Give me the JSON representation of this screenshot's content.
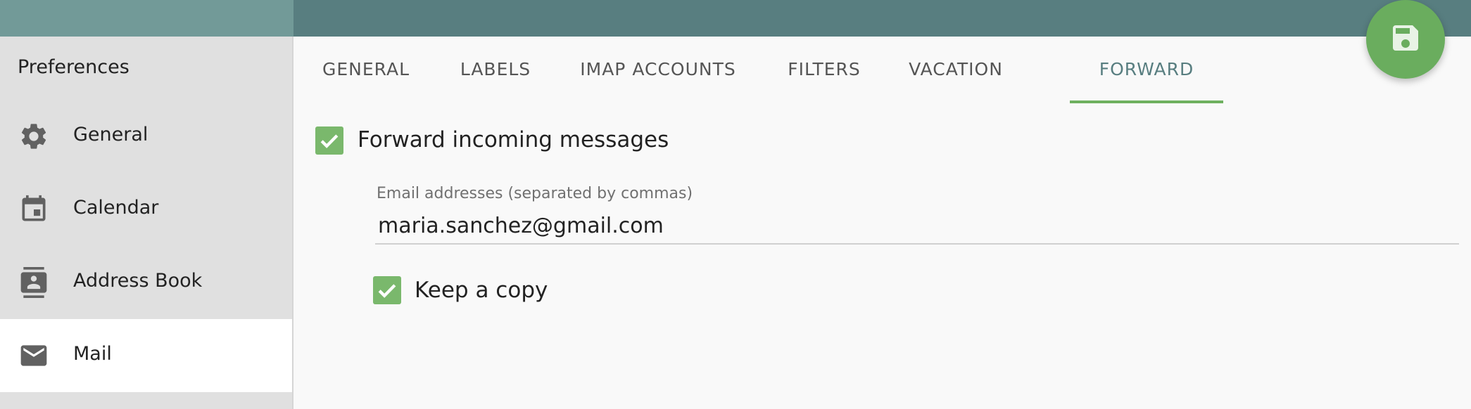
{
  "colors": {
    "topbar_left": "#729a98",
    "topbar_right": "#587e80",
    "accent_green": "#6aad5e",
    "active_tab_text": "#587e80"
  },
  "sidebar": {
    "title": "Preferences",
    "items": [
      {
        "label": "General",
        "icon": "gear-icon",
        "active": false
      },
      {
        "label": "Calendar",
        "icon": "calendar-icon",
        "active": false
      },
      {
        "label": "Address Book",
        "icon": "contact-card-icon",
        "active": false
      },
      {
        "label": "Mail",
        "icon": "mail-icon",
        "active": true
      }
    ]
  },
  "tabs": [
    {
      "label": "GENERAL",
      "active": false
    },
    {
      "label": "LABELS",
      "active": false
    },
    {
      "label": "IMAP ACCOUNTS",
      "active": false
    },
    {
      "label": "FILTERS",
      "active": false
    },
    {
      "label": "VACATION",
      "active": false
    },
    {
      "label": "FORWARD",
      "active": true
    }
  ],
  "fab": {
    "icon": "save-icon"
  },
  "forward": {
    "enable_label": "Forward incoming messages",
    "enable_checked": true,
    "email_label": "Email addresses (separated by commas)",
    "email_value": "maria.sanchez@gmail.com",
    "keep_copy_label": "Keep a copy",
    "keep_copy_checked": true
  }
}
